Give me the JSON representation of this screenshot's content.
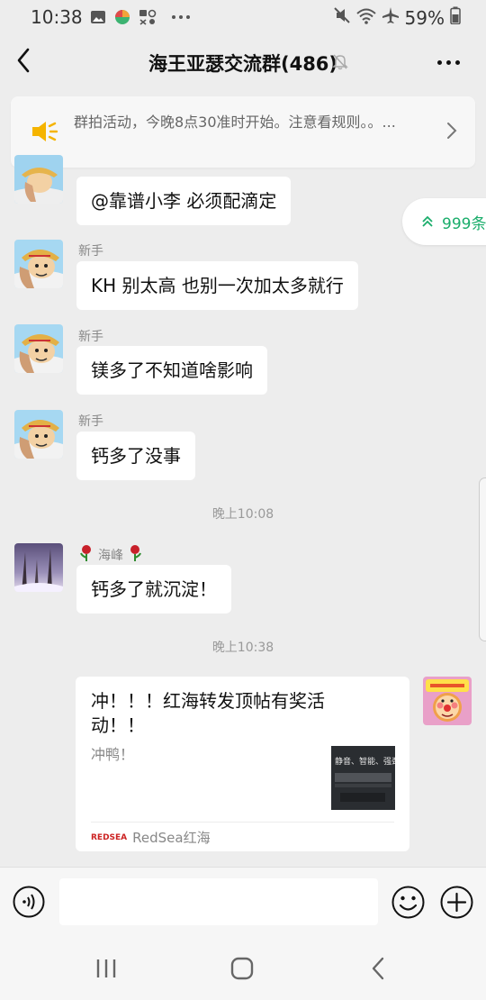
{
  "status_bar": {
    "time": "10:38",
    "battery": "59%"
  },
  "header": {
    "title": "海王亚瑟交流群(486)"
  },
  "notice": {
    "text": "群拍活动，今晚8点30准时开始。注意看规则。。..."
  },
  "unread": {
    "count_label": "999条"
  },
  "messages": [
    {
      "sender": "",
      "text": "@靠谱小李  必须配滴定"
    },
    {
      "sender": "新手",
      "text": "KH 别太高 也别一次加太多就行"
    },
    {
      "sender": "新手",
      "text": "镁多了不知道啥影响"
    },
    {
      "sender": "新手",
      "text": "钙多了没事"
    },
    {
      "sender": "海峰",
      "text": "钙多了就沉淀！"
    }
  ],
  "timestamps": [
    "晚上10:08",
    "晚上10:38"
  ],
  "link_card": {
    "title": "冲！！！红海转发顶帖有奖活动！！",
    "description": "冲鸭！",
    "thumb_text": "静音、智能、强劲",
    "source": "RedSea红海",
    "source_logo": "REDSEA"
  },
  "input": {
    "placeholder": ""
  },
  "colors": {
    "background": "#ededed",
    "bubble": "#ffffff",
    "accent_green": "#1aad6b",
    "notice_icon": "#f5b400"
  },
  "icons": [
    "back-icon",
    "mute-bell-icon",
    "more-icon",
    "speaker-icon",
    "chevron-right-icon",
    "double-chevron-up-icon",
    "voice-icon",
    "emoji-icon",
    "plus-icon",
    "recent-apps-icon",
    "home-icon",
    "nav-back-icon"
  ]
}
